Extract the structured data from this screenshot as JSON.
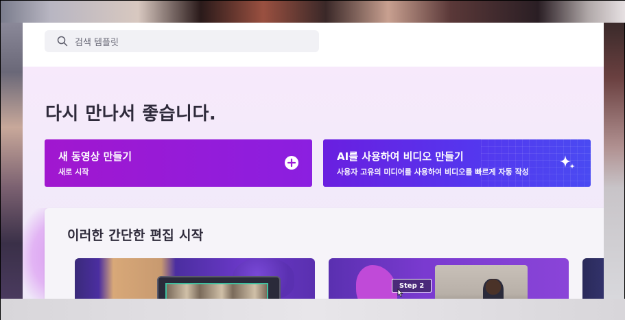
{
  "search": {
    "placeholder": "검색 템플릿"
  },
  "hero": {
    "greeting": "다시 만나서 좋습니다."
  },
  "cards": {
    "new_video": {
      "title": "새 동영상 만들기",
      "subtitle": "새로 시작"
    },
    "ai_video": {
      "title": "AI를 사용하여 비디오 만들기",
      "subtitle": "사용자 고유의 미디어를 사용하여 비디오를 빠르게 자동 작성"
    }
  },
  "templates": {
    "title": "이러한 간단한 편집 시작",
    "thumbnails": [
      {
        "tag": ""
      },
      {
        "tag": "Step 2"
      },
      {
        "tag": ""
      }
    ]
  },
  "colors": {
    "new_card": "#a117cf",
    "ai_card": "#5536ee",
    "background": "#f3eefa"
  }
}
